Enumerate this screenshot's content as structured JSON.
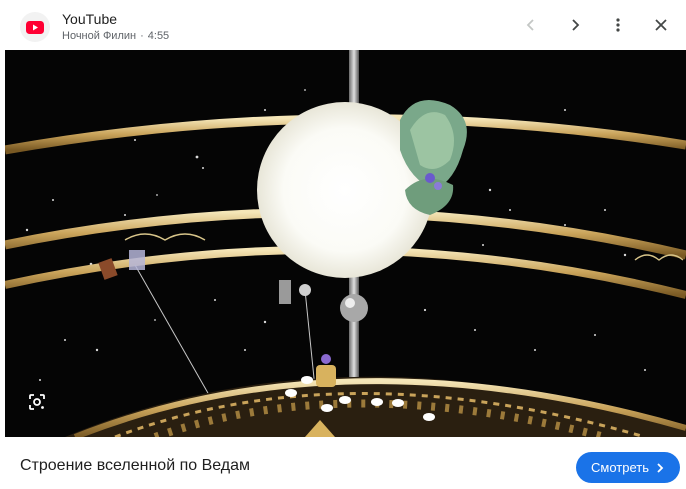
{
  "header": {
    "app_name": "YouTube",
    "channel": "Ночной Филин",
    "separator": "·",
    "duration": "4:55",
    "icons": {
      "logo": "youtube-logo-icon",
      "back": "chevron-left-icon",
      "forward": "chevron-right-icon",
      "menu": "more-vert-icon",
      "close": "close-icon"
    }
  },
  "video": {
    "lens_icon": "lens-search-icon"
  },
  "footer": {
    "video_title": "Строение вселенной по Ведам",
    "watch_label": "Смотреть",
    "watch_icon": "chevron-right-icon"
  },
  "colors": {
    "accent": "#1a73e8",
    "youtube_red": "#ff0033",
    "text_secondary": "#5f6368"
  }
}
